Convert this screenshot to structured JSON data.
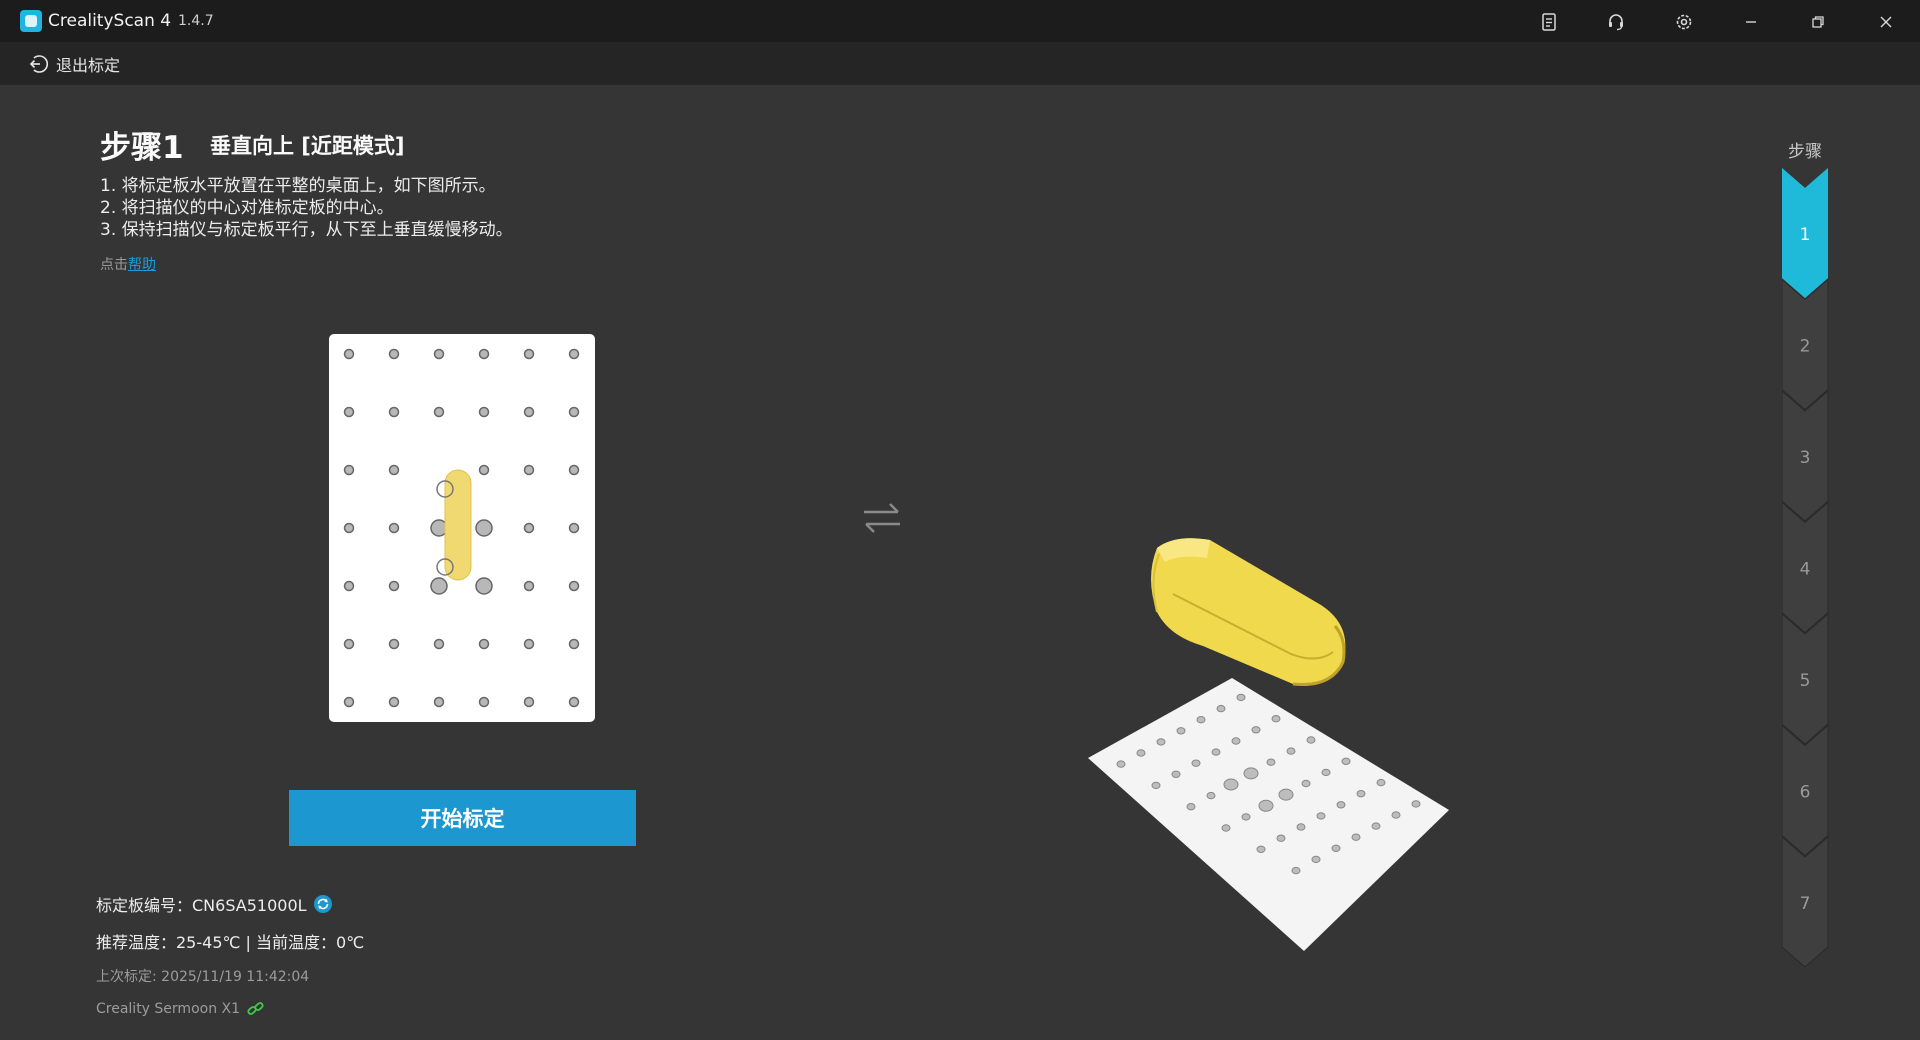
{
  "app": {
    "name": "CrealityScan 4",
    "version": "1.4.7"
  },
  "titlebar": {
    "icons": [
      "notes-icon",
      "headset-icon",
      "settings-icon",
      "minimize-icon",
      "restore-icon",
      "close-icon"
    ]
  },
  "subheader": {
    "exit_label": "退出标定",
    "icon": "exit-arrow-icon"
  },
  "step": {
    "title": "步骤1",
    "subtitle": "垂直向上 [近距模式]",
    "instructions": [
      "1. 将标定板水平放置在平整的桌面上，如下图所示。",
      "2. 将扫描仪的中心对准标定板的中心。",
      "3. 保持扫描仪与标定板平行，从下至上垂直缓慢移动。"
    ],
    "help_prefix": "点击",
    "help_link": "帮助"
  },
  "start_button": "开始标定",
  "info": {
    "board_id": "标定板编号：CN6SA51000L",
    "temperature": "推荐温度：25-45℃ | 当前温度：0℃",
    "last_calibration": "上次标定: 2025/11/19 11:42:04",
    "device": "Creality Sermoon X1"
  },
  "steps_sidebar": {
    "label": "步骤",
    "items": [
      "1",
      "2",
      "3",
      "4",
      "5",
      "6",
      "7"
    ],
    "active_index": 0
  },
  "colors": {
    "accent": "#1c97d0",
    "active_step": "#1fb9d9",
    "scanner_yellow": "#f2dc5d",
    "background": "#353535"
  }
}
